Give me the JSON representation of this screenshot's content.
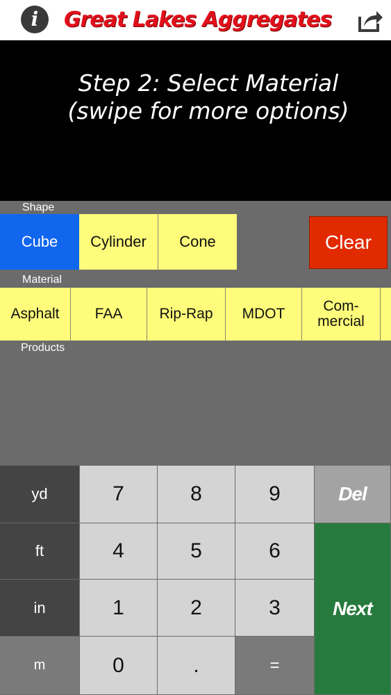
{
  "header": {
    "info_icon": "i",
    "title": "Great Lakes Aggregates",
    "share_icon": "share-icon"
  },
  "instruction": {
    "line1": "Step 2: Select Material",
    "line2": "(swipe for more options)"
  },
  "shape": {
    "label": "Shape",
    "options": [
      "Cube",
      "Cylinder",
      "Cone"
    ],
    "selected": "Cube",
    "clear_label": "Clear"
  },
  "material": {
    "label": "Material",
    "options": [
      "Asphalt",
      "FAA",
      "Rip-Rap",
      "MDOT",
      "Com-\nmercial"
    ]
  },
  "products": {
    "label": "Products"
  },
  "keypad": {
    "units": [
      "yd",
      "ft",
      "in",
      "m"
    ],
    "digits": [
      "7",
      "8",
      "9",
      "4",
      "5",
      "6",
      "1",
      "2",
      "3",
      "0",
      "."
    ],
    "del_label": "Del",
    "next_label": "Next",
    "equals_label": "="
  },
  "colors": {
    "selected": "#1166ee",
    "option": "#fefc7a",
    "clear": "#e12a00",
    "next": "#277a3d",
    "title": "#e2101c"
  }
}
